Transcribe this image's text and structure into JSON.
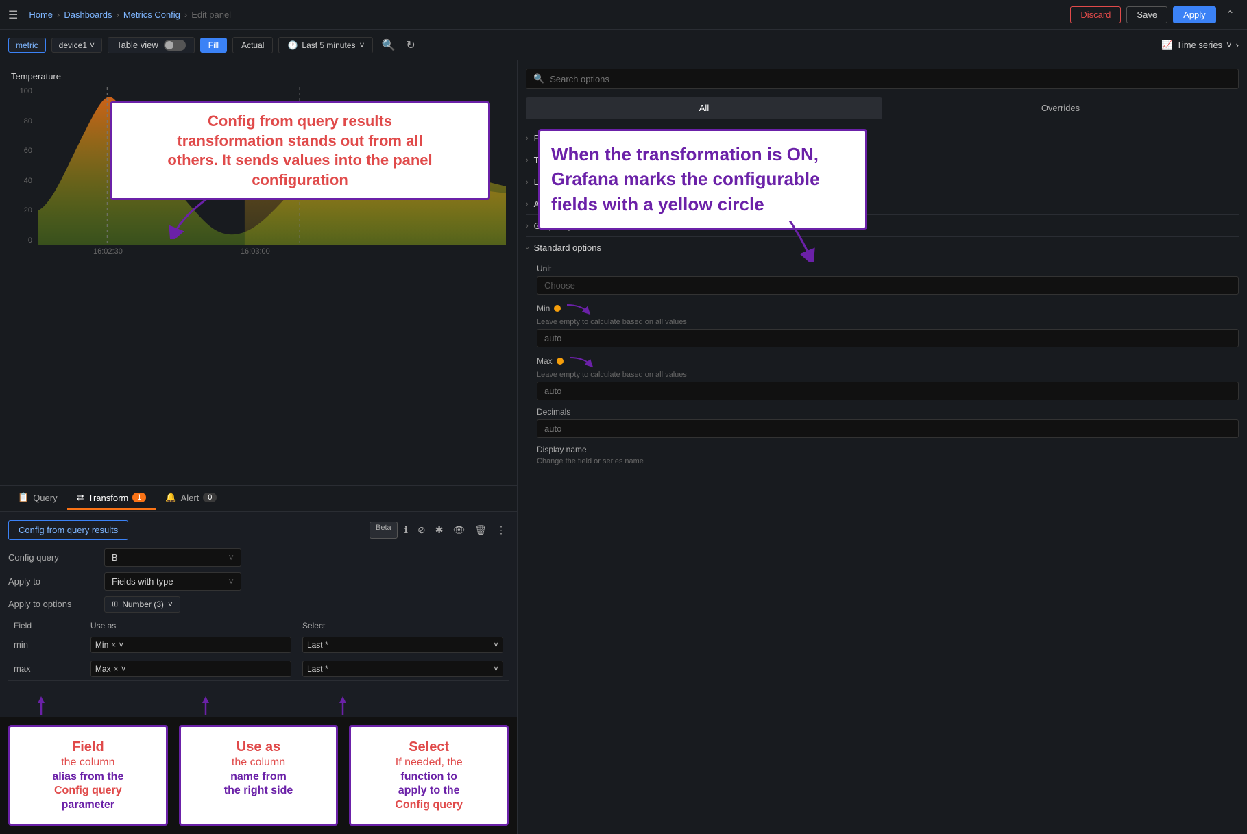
{
  "topbar": {
    "menu_icon": "☰",
    "breadcrumb": [
      "Home",
      "Dashboards",
      "Metrics Config",
      "Edit panel"
    ],
    "breadcrumb_separators": [
      ">",
      ">",
      ">"
    ],
    "discard_label": "Discard",
    "save_label": "Save",
    "apply_label": "Apply",
    "collapse_icon": "⌃"
  },
  "toolbar": {
    "metric_tag": "metric",
    "device_label": "device1",
    "table_view_label": "Table view",
    "fill_label": "Fill",
    "actual_label": "Actual",
    "time_icon": "🕐",
    "time_label": "Last 5 minutes",
    "zoom_icon": "🔍",
    "refresh_icon": "↻",
    "panel_type_icon": "📈",
    "panel_type_label": "Time series",
    "chevron_down": "˅",
    "chevron_right": ">"
  },
  "chart": {
    "title": "Temperature",
    "y_axis": [
      "100",
      "80",
      "60",
      "40",
      "20",
      "0"
    ],
    "x_axis": [
      "16:02:30",
      "16:03:00"
    ],
    "dashed_line_1": "16:02:30",
    "dashed_line_2": "16:03:00"
  },
  "callout_main": {
    "line1": "Config from query results",
    "line2": "transformation stands out from all",
    "line3": "others. It sends values into the panel",
    "line4": "configuration"
  },
  "callout_right": {
    "line1": "When the transformation is ON,",
    "line2": "Grafana marks the configurable",
    "line3": "fields with a yellow circle"
  },
  "tabs": {
    "query": {
      "icon": "📋",
      "label": "Query"
    },
    "transform": {
      "icon": "⇄",
      "label": "Transform",
      "count": "1"
    },
    "alert": {
      "icon": "🔔",
      "label": "Alert",
      "count": "0"
    }
  },
  "transform": {
    "title": "Config from query results",
    "beta_label": "Beta",
    "icons": [
      "ℹ",
      "⊘",
      "✱",
      "👁",
      "🗑",
      "⋮"
    ],
    "config_query_label": "Config query",
    "config_query_value": "B",
    "apply_to_label": "Apply to",
    "apply_to_value": "Fields with type",
    "apply_to_options_label": "Apply to options",
    "apply_to_number": "Number (3)",
    "field_col": "Field",
    "use_as_col": "Use as",
    "select_col": "Select",
    "rows": [
      {
        "field": "min",
        "use_as": "Min",
        "select": "Last *"
      },
      {
        "field": "max",
        "use_as": "Max",
        "select": "Last *"
      }
    ]
  },
  "options": {
    "search_placeholder": "Search options",
    "tabs": [
      "All",
      "Overrides"
    ],
    "sections": [
      "Panel options",
      "Tooltip",
      "Legend",
      "Axis",
      "Graph style",
      "Standard options"
    ],
    "standard_options": {
      "unit_label": "Unit",
      "unit_placeholder": "Choose",
      "min_label": "Min",
      "min_hint": "Leave empty to calculate based on all values",
      "min_value": "auto",
      "max_label": "Max",
      "max_hint": "Leave empty to calculate based on all values",
      "max_value": "auto",
      "decimals_label": "Decimals",
      "decimals_value": "auto",
      "display_name_label": "Display name",
      "display_name_hint": "Change the field or series name"
    }
  },
  "bottom_annotations": {
    "field_title": "Field",
    "field_desc_red": "the column",
    "field_desc2": "alias from the",
    "field_desc3": "Config query",
    "field_desc4": "parameter",
    "use_as_title": "Use as",
    "use_as_desc_red": "the column",
    "use_as_desc2": "name from",
    "use_as_desc3": "the right side",
    "select_title": "Select",
    "select_desc_red": "If needed, the",
    "select_desc2": "function to",
    "select_desc3": "apply to the",
    "select_desc4": "Config query"
  }
}
